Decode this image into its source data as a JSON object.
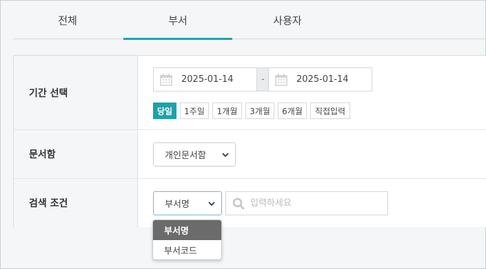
{
  "tabs": [
    {
      "label": "전체"
    },
    {
      "label": "부서",
      "active": true
    },
    {
      "label": "사용자"
    }
  ],
  "accent_color": "#1aa3a9",
  "period": {
    "label": "기간 선택",
    "start": "2025-01-14",
    "separator": "-",
    "end": "2025-01-14",
    "icon": "calendar-icon",
    "quick": [
      "당일",
      "1주일",
      "1개월",
      "3개월",
      "6개월",
      "직접입력"
    ],
    "active_quick": "당일"
  },
  "docbox": {
    "label": "문서함",
    "selected": "개인문서함"
  },
  "search": {
    "label": "검색 조건",
    "selected": "부서명",
    "placeholder": "입력하세요",
    "options": [
      "부서명",
      "부서코드"
    ]
  }
}
